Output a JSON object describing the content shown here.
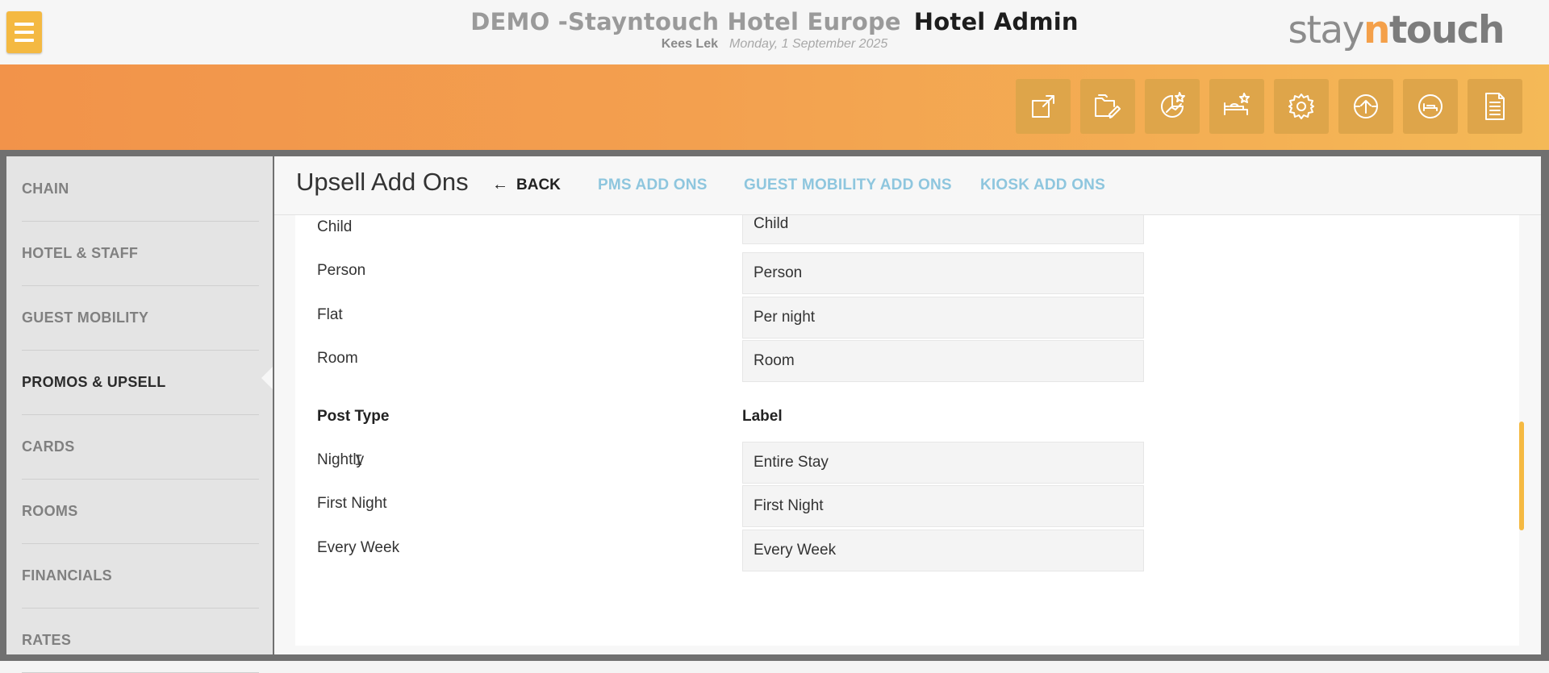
{
  "header": {
    "hotel_name": "DEMO -Stayntouch Hotel Europe",
    "app_name": "Hotel Admin",
    "user": "Kees Lek",
    "date": "Monday, 1 September 2025",
    "logo": {
      "part1": "stay",
      "part2": "n",
      "part3": "touch"
    }
  },
  "toolbar": {
    "icons": [
      "external-link-icon",
      "folder-edit-icon",
      "chart-star-icon",
      "bed-star-icon",
      "gear-icon",
      "upload-circle-icon",
      "bed-circle-icon",
      "document-icon"
    ]
  },
  "sidebar": {
    "items": [
      {
        "label": "CHAIN",
        "active": false
      },
      {
        "label": "HOTEL & STAFF",
        "active": false
      },
      {
        "label": "GUEST MOBILITY",
        "active": false
      },
      {
        "label": "PROMOS & UPSELL",
        "active": true
      },
      {
        "label": "CARDS",
        "active": false
      },
      {
        "label": "ROOMS",
        "active": false
      },
      {
        "label": "FINANCIALS",
        "active": false
      },
      {
        "label": "RATES",
        "active": false
      }
    ]
  },
  "content": {
    "title": "Upsell Add Ons",
    "back_label": "BACK",
    "tabs": [
      "PMS ADD ONS",
      "GUEST MOBILITY ADD ONS",
      "KIOSK ADD ONS"
    ]
  },
  "amount_types": [
    {
      "label": "Child",
      "value": "Child"
    },
    {
      "label": "Person",
      "value": "Person"
    },
    {
      "label": "Flat",
      "value": "Per night"
    },
    {
      "label": "Room",
      "value": "Room"
    }
  ],
  "post_types": {
    "header_type": "Post Type",
    "header_label": "Label",
    "rows": [
      {
        "label": "Nightly",
        "value": "Entire Stay"
      },
      {
        "label": "First Night",
        "value": "First Night"
      },
      {
        "label": "Every Week",
        "value": "Every Week"
      }
    ]
  },
  "colors": {
    "accent": "#f4b942",
    "orange_start": "#f2934a",
    "orange_end": "#f4b957",
    "tab_link": "#8ec6de"
  }
}
